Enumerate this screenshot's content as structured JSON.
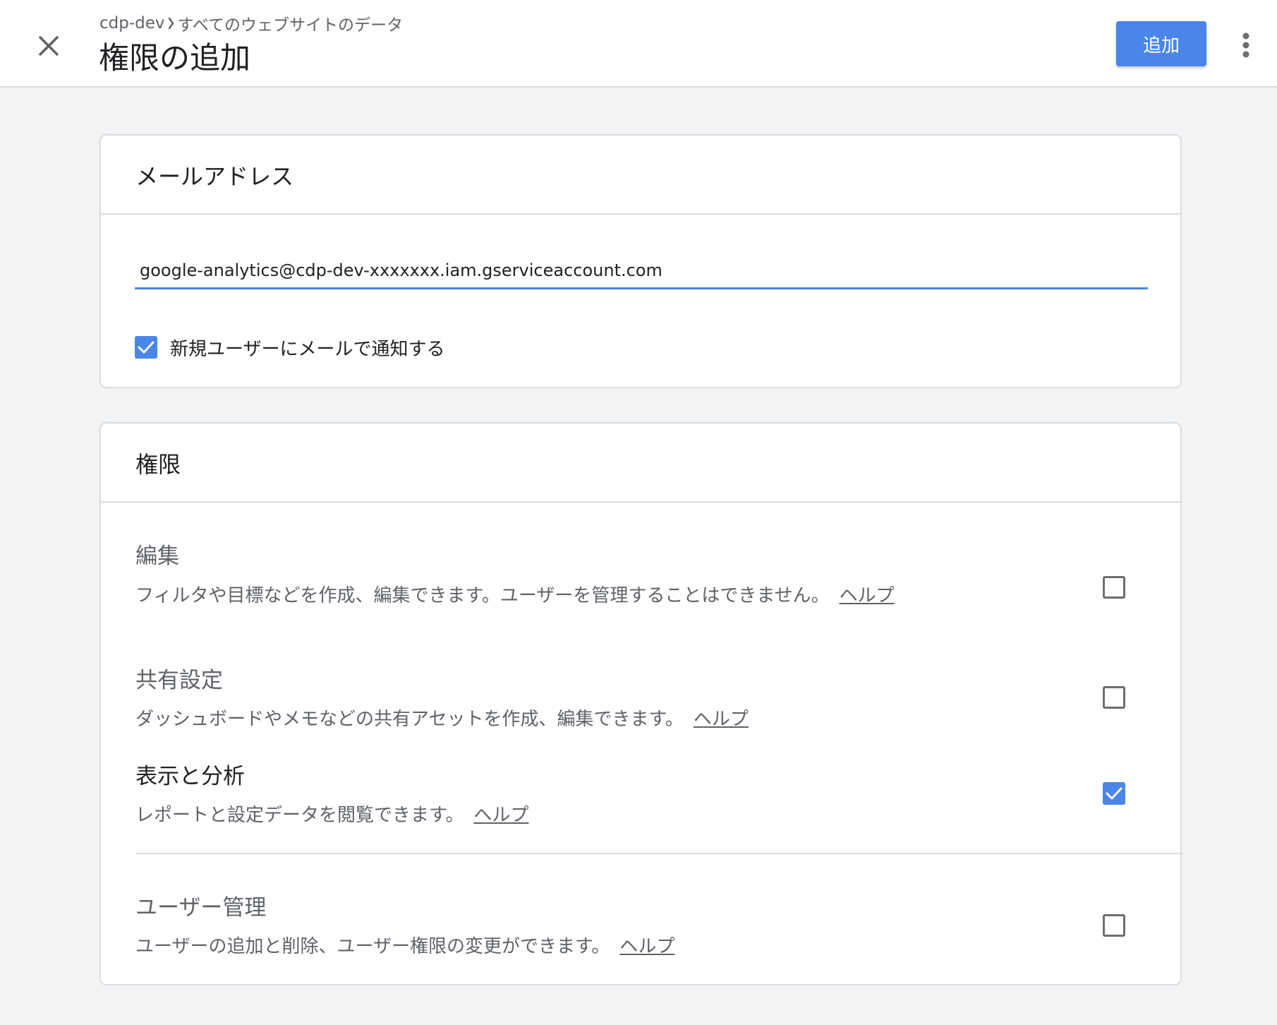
{
  "header": {
    "breadcrumb_account": "cdp-dev",
    "breadcrumb_property": "すべてのウェブサイトのデータ",
    "title": "権限の追加",
    "add_button_label": "追加"
  },
  "email_section": {
    "title": "メールアドレス",
    "email_value": "google-analytics@cdp-dev-xxxxxxx.iam.gserviceaccount.com",
    "notify_label": "新規ユーザーにメールで通知する",
    "notify_checked": true
  },
  "permissions_section": {
    "title": "権限",
    "items": [
      {
        "title": "編集",
        "description": "フィルタや目標などを作成、編集できます。ユーザーを管理することはできません。",
        "help_label": "ヘルプ",
        "checked": false
      },
      {
        "title": "共有設定",
        "description": "ダッシュボードやメモなどの共有アセットを作成、編集できます。",
        "help_label": "ヘルプ",
        "checked": false
      },
      {
        "title": "表示と分析",
        "description": "レポートと設定データを閲覧できます。",
        "help_label": "ヘルプ",
        "checked": true
      },
      {
        "title": "ユーザー管理",
        "description": "ユーザーの追加と削除、ユーザー権限の変更ができます。",
        "help_label": "ヘルプ",
        "checked": false
      }
    ]
  },
  "icons": {
    "close": "close-icon",
    "more": "more-vert-icon",
    "breadcrumb_separator": "chevron-right-icon",
    "check": "check-icon"
  },
  "colors": {
    "accent": "#4a86e8",
    "background": "#f1f3f4",
    "card": "#ffffff",
    "border": "#dadce0",
    "text_primary": "#202124",
    "text_secondary": "#5f6368"
  }
}
